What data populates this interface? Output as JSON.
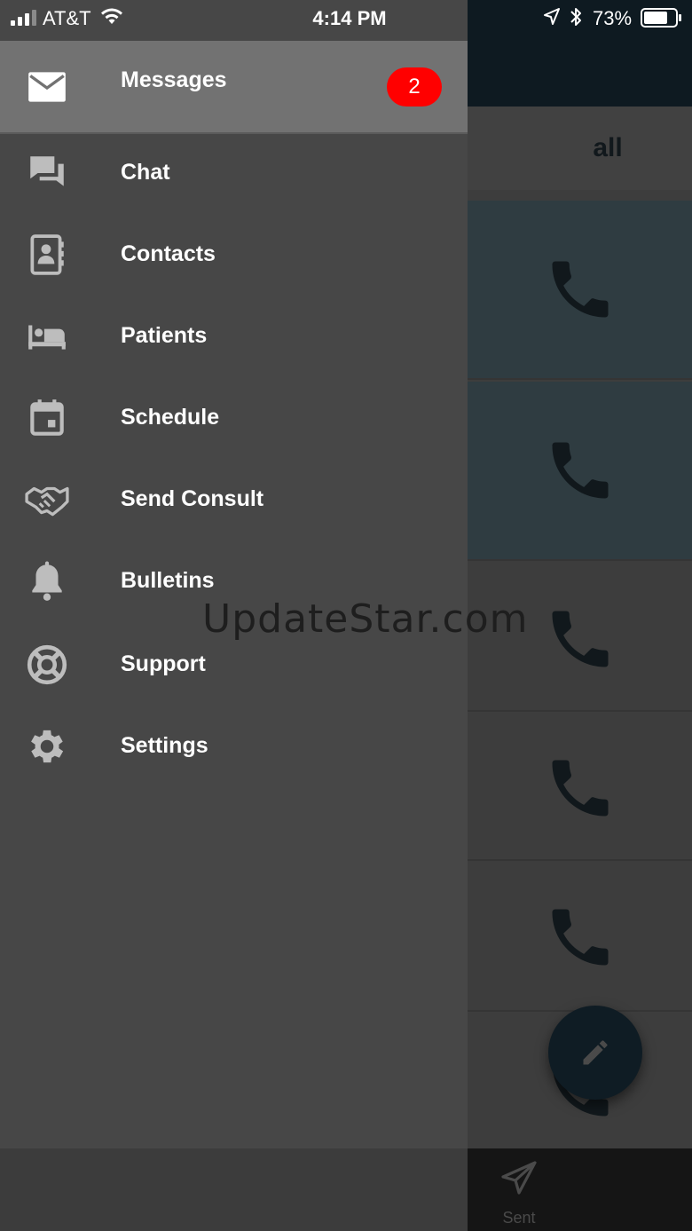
{
  "status_bar": {
    "carrier": "AT&T",
    "time": "4:14 PM",
    "battery_percent": "73%"
  },
  "drawer": {
    "items": [
      {
        "label": "Messages",
        "icon": "envelope-icon",
        "badge": "2",
        "active": true
      },
      {
        "label": "Chat",
        "icon": "chat-bubbles-icon"
      },
      {
        "label": "Contacts",
        "icon": "contacts-book-icon"
      },
      {
        "label": "Patients",
        "icon": "hospital-bed-icon"
      },
      {
        "label": "Schedule",
        "icon": "calendar-icon"
      },
      {
        "label": "Send Consult",
        "icon": "handshake-icon"
      },
      {
        "label": "Bulletins",
        "icon": "bell-icon"
      },
      {
        "label": "Support",
        "icon": "lifebuoy-icon"
      },
      {
        "label": "Settings",
        "icon": "gear-icon"
      }
    ]
  },
  "background": {
    "filter_label": "all",
    "tab_sent_label": "Sent"
  },
  "watermark": "UpdateStar.com",
  "colors": {
    "badge": "#ff0000",
    "active_item": "#727272",
    "drawer_bg": "#474747",
    "header_bg": "#0e1a21",
    "highlight_row": "#2f3c41"
  }
}
